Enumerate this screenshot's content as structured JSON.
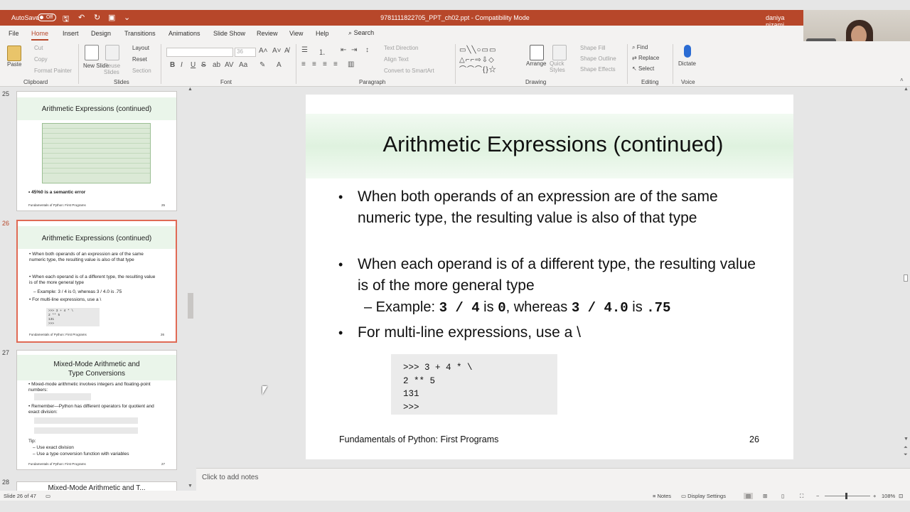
{
  "titlebar": {
    "autosave_label": "AutoSave",
    "autosave_state": "Off",
    "document_title": "9781111822705_PPT_ch02.ppt  -  Compatibility Mode",
    "user_name": "daniya nizami"
  },
  "ribbon_tabs": [
    "File",
    "Home",
    "Insert",
    "Design",
    "Transitions",
    "Animations",
    "Slide Show",
    "Review",
    "View",
    "Help"
  ],
  "ribbon_search": "Search",
  "ribbon": {
    "clipboard": {
      "label": "Clipboard",
      "paste": "Paste",
      "cut": "Cut",
      "copy": "Copy",
      "format_painter": "Format Painter"
    },
    "slides": {
      "label": "Slides",
      "new_slide": "New Slide",
      "reuse_slides": "Reuse Slides",
      "layout": "Layout",
      "reset": "Reset",
      "section": "Section"
    },
    "font": {
      "label": "Font",
      "size_value": "36"
    },
    "paragraph": {
      "label": "Paragraph",
      "text_direction": "Text Direction",
      "align_text": "Align Text",
      "convert_smartart": "Convert to SmartArt"
    },
    "drawing": {
      "label": "Drawing",
      "arrange": "Arrange",
      "quick_styles": "Quick Styles",
      "shape_fill": "Shape Fill",
      "shape_outline": "Shape Outline",
      "shape_effects": "Shape Effects"
    },
    "editing": {
      "label": "Editing",
      "find": "Find",
      "replace": "Replace",
      "select": "Select"
    },
    "voice": {
      "label": "Voice",
      "dictate": "Dictate"
    }
  },
  "thumbnails": [
    {
      "number": "25",
      "title": "Arithmetic Expressions (continued)",
      "bullet": "45%0 is a semantic error",
      "footer": "Fundamentals of Python: First Programs",
      "page": "25"
    },
    {
      "number": "26",
      "title": "Arithmetic Expressions (continued)",
      "bullets": [
        "When both operands of an expression are of the same numeric type, the resulting value is also of that type",
        "When each operand is of a different type, the resulting value is of the more general type",
        "– Example: 3 / 4 is 0, whereas 3 / 4.0 is .75",
        "For multi-line expressions, use a \\"
      ],
      "code": ">>> 3 + 4 * \\\n2 ** 5\n131\n>>>",
      "footer": "Fundamentals of Python: First Programs",
      "page": "26"
    },
    {
      "number": "27",
      "title": "Mixed-Mode Arithmetic and Type Conversions",
      "bullets": [
        "Mixed-mode arithmetic involves integers and floating-point numbers:",
        "Remember—Python has different operators for quotient and exact division:",
        "Tip:",
        "– Use exact division",
        "– Use a type conversion function with variables"
      ],
      "footer": "Fundamentals of Python: First Programs",
      "page": "27"
    },
    {
      "number": "28",
      "title": "Mixed-Mode Arithmetic and T..."
    }
  ],
  "slide": {
    "title": "Arithmetic Expressions (continued)",
    "bullet1": "When both operands of an expression are of the same numeric type, the resulting value is also of that type",
    "bullet2": "When each operand is of a different type, the resulting value is of the more general type",
    "example": {
      "prefix": "– Example: ",
      "code1": "3 / 4",
      "is1": " is ",
      "code2": "0",
      "whereas": ", whereas ",
      "code3": "3 / 4.0",
      "is2": " is ",
      "code4": ".75"
    },
    "bullet3": "For multi-line expressions, use a \\",
    "code": ">>> 3 + 4 * \\\n2 ** 5\n131\n>>>",
    "footer": "Fundamentals of Python: First Programs",
    "page_number": "26"
  },
  "notes_placeholder": "Click to add notes",
  "status": {
    "slide_info": "Slide 26 of 47",
    "notes": "Notes",
    "display_settings": "Display Settings",
    "zoom": "108%"
  }
}
